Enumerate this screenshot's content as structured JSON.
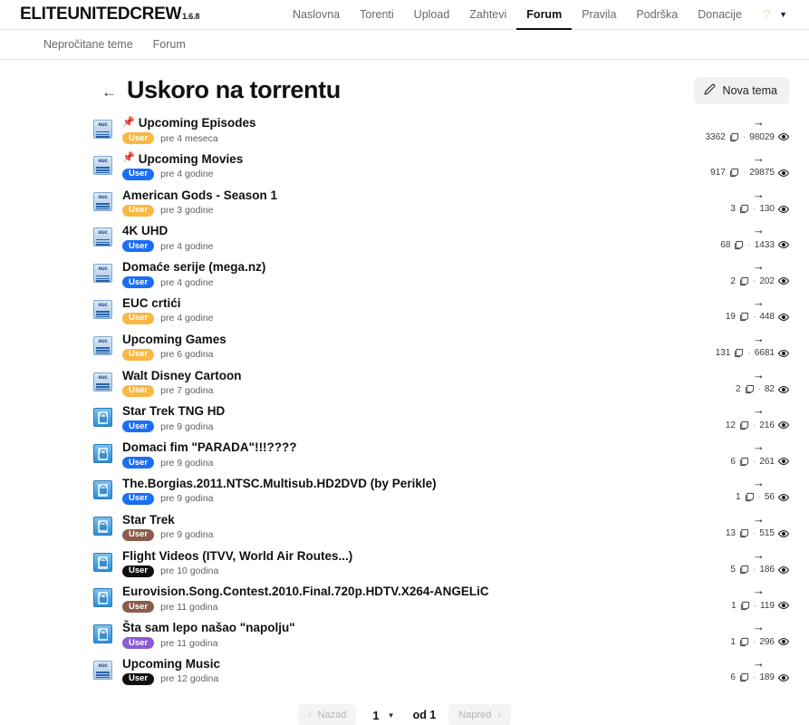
{
  "header": {
    "brand_name": "ELITEUNITEDCREW",
    "brand_version": "1.6.8",
    "nav": [
      {
        "label": "Naslovna",
        "active": false
      },
      {
        "label": "Torenti",
        "active": false
      },
      {
        "label": "Upload",
        "active": false
      },
      {
        "label": "Zahtevi",
        "active": false
      },
      {
        "label": "Forum",
        "active": true
      },
      {
        "label": "Pravila",
        "active": false
      },
      {
        "label": "Podrška",
        "active": false
      },
      {
        "label": "Donacije",
        "active": false
      }
    ],
    "help_icon": "question-mark-icon",
    "help_glyph": "?",
    "caret_glyph": "▼"
  },
  "subnav": {
    "items": [
      {
        "label": "Nepročitane teme"
      },
      {
        "label": "Forum"
      }
    ]
  },
  "page": {
    "back_glyph": "←",
    "title": "Uskoro na torrentu",
    "new_topic_label": "Nova tema"
  },
  "threads": [
    {
      "title": "Upcoming Episodes",
      "pinned": true,
      "avatar": "euc",
      "badge": "User",
      "badge_color": "#f7b844",
      "when": "pre 4 meseca",
      "replies": "3362",
      "views": "98029"
    },
    {
      "title": "Upcoming Movies",
      "pinned": true,
      "avatar": "euc",
      "badge": "User",
      "badge_color": "#1b6ef5",
      "when": "pre 4 godine",
      "replies": "917",
      "views": "29875"
    },
    {
      "title": "American Gods - Season 1",
      "pinned": false,
      "avatar": "euc",
      "badge": "User",
      "badge_color": "#f7b844",
      "when": "pre 3 godine",
      "replies": "3",
      "views": "130"
    },
    {
      "title": "4K UHD",
      "pinned": false,
      "avatar": "euc",
      "badge": "User",
      "badge_color": "#1b6ef5",
      "when": "pre 4 godine",
      "replies": "68",
      "views": "1433"
    },
    {
      "title": "Domaće serije (mega.nz)",
      "pinned": false,
      "avatar": "euc",
      "badge": "User",
      "badge_color": "#1b6ef5",
      "when": "pre 4 godine",
      "replies": "2",
      "views": "202"
    },
    {
      "title": "EUC crtići",
      "pinned": false,
      "avatar": "euc",
      "badge": "User",
      "badge_color": "#f7b844",
      "when": "pre 4 godine",
      "replies": "19",
      "views": "448"
    },
    {
      "title": "Upcoming Games",
      "pinned": false,
      "avatar": "euc",
      "badge": "User",
      "badge_color": "#f7b844",
      "when": "pre 6 godina",
      "replies": "131",
      "views": "6681"
    },
    {
      "title": "Walt Disney Cartoon",
      "pinned": false,
      "avatar": "euc",
      "badge": "User",
      "badge_color": "#f7b844",
      "when": "pre 7 godina",
      "replies": "2",
      "views": "82"
    },
    {
      "title": "Star Trek TNG HD",
      "pinned": false,
      "avatar": "lock",
      "badge": "User",
      "badge_color": "#1b6ef5",
      "when": "pre 9 godina",
      "replies": "12",
      "views": "216"
    },
    {
      "title": "Domaci fim \"PARADA\"!!!????",
      "pinned": false,
      "avatar": "lock",
      "badge": "User",
      "badge_color": "#1b6ef5",
      "when": "pre 9 godina",
      "replies": "6",
      "views": "261"
    },
    {
      "title": "The.Borgias.2011.NTSC.Multisub.HD2DVD (by Perikle)",
      "pinned": false,
      "avatar": "lock",
      "badge": "User",
      "badge_color": "#1b6ef5",
      "when": "pre 9 godina",
      "replies": "1",
      "views": "56"
    },
    {
      "title": "Star Trek",
      "pinned": false,
      "avatar": "lock",
      "badge": "User",
      "badge_color": "#8b5c4b",
      "when": "pre 9 godina",
      "replies": "13",
      "views": "515"
    },
    {
      "title": "Flight Videos (ITVV, World Air Routes...)",
      "pinned": false,
      "avatar": "lock",
      "badge": "User",
      "badge_color": "#111111",
      "when": "pre 10 godina",
      "replies": "5",
      "views": "186"
    },
    {
      "title": "Eurovision.Song.Contest.2010.Final.720p.HDTV.X264-ANGELiC",
      "pinned": false,
      "avatar": "lock",
      "badge": "User",
      "badge_color": "#8b5c4b",
      "when": "pre 11 godina",
      "replies": "1",
      "views": "119"
    },
    {
      "title": "Šta sam lepo našao \"napolju\"",
      "pinned": false,
      "avatar": "lock",
      "badge": "User",
      "badge_color": "#8a5cd8",
      "when": "pre 11 godina",
      "replies": "1",
      "views": "296"
    },
    {
      "title": "Upcoming Music",
      "pinned": false,
      "avatar": "euc",
      "badge": "User",
      "badge_color": "#111111",
      "when": "pre 12 godina",
      "replies": "6",
      "views": "189"
    }
  ],
  "pagination": {
    "prev_label": "Nazad",
    "next_label": "Napred",
    "current_page": "1",
    "of_label": "od 1",
    "prev_chevron": "‹",
    "next_chevron": "›",
    "select_caret": "▼"
  },
  "icons": {
    "pin": "📌",
    "last_post_arrow": "→"
  }
}
